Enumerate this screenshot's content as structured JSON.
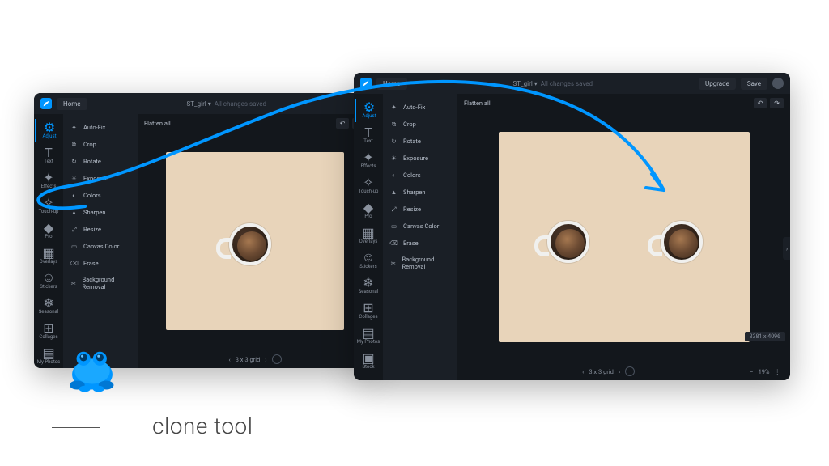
{
  "caption": "clone tool",
  "editor": {
    "home": "Home",
    "filename": "ST_girl",
    "save_status": "All changes saved",
    "upgrade": "Upgrade",
    "save": "Save",
    "flatten": "Flatten all",
    "grid_label": "3 x 3 grid",
    "zoom": "19%",
    "dimensions": "3381 x 4096"
  },
  "rail": [
    {
      "label": "Adjust"
    },
    {
      "label": "Text"
    },
    {
      "label": "Effects"
    },
    {
      "label": "Touch-up"
    },
    {
      "label": "Pro"
    },
    {
      "label": "Overlays"
    },
    {
      "label": "Stickers"
    },
    {
      "label": "Seasonal"
    },
    {
      "label": "Collages"
    },
    {
      "label": "My Photos"
    },
    {
      "label": "Stock"
    }
  ],
  "tools": [
    {
      "label": "Auto-Fix"
    },
    {
      "label": "Crop"
    },
    {
      "label": "Rotate"
    },
    {
      "label": "Exposure"
    },
    {
      "label": "Colors"
    },
    {
      "label": "Sharpen"
    },
    {
      "label": "Resize"
    },
    {
      "label": "Canvas Color"
    },
    {
      "label": "Erase"
    },
    {
      "label": "Background Removal"
    }
  ],
  "icons": {
    "auto": "✦",
    "crop": "⧉",
    "rotate": "↻",
    "exposure": "☀",
    "colors": "◐",
    "sharpen": "▲",
    "resize": "⤢",
    "canvas": "▭",
    "erase": "⌫",
    "bg": "✂"
  }
}
